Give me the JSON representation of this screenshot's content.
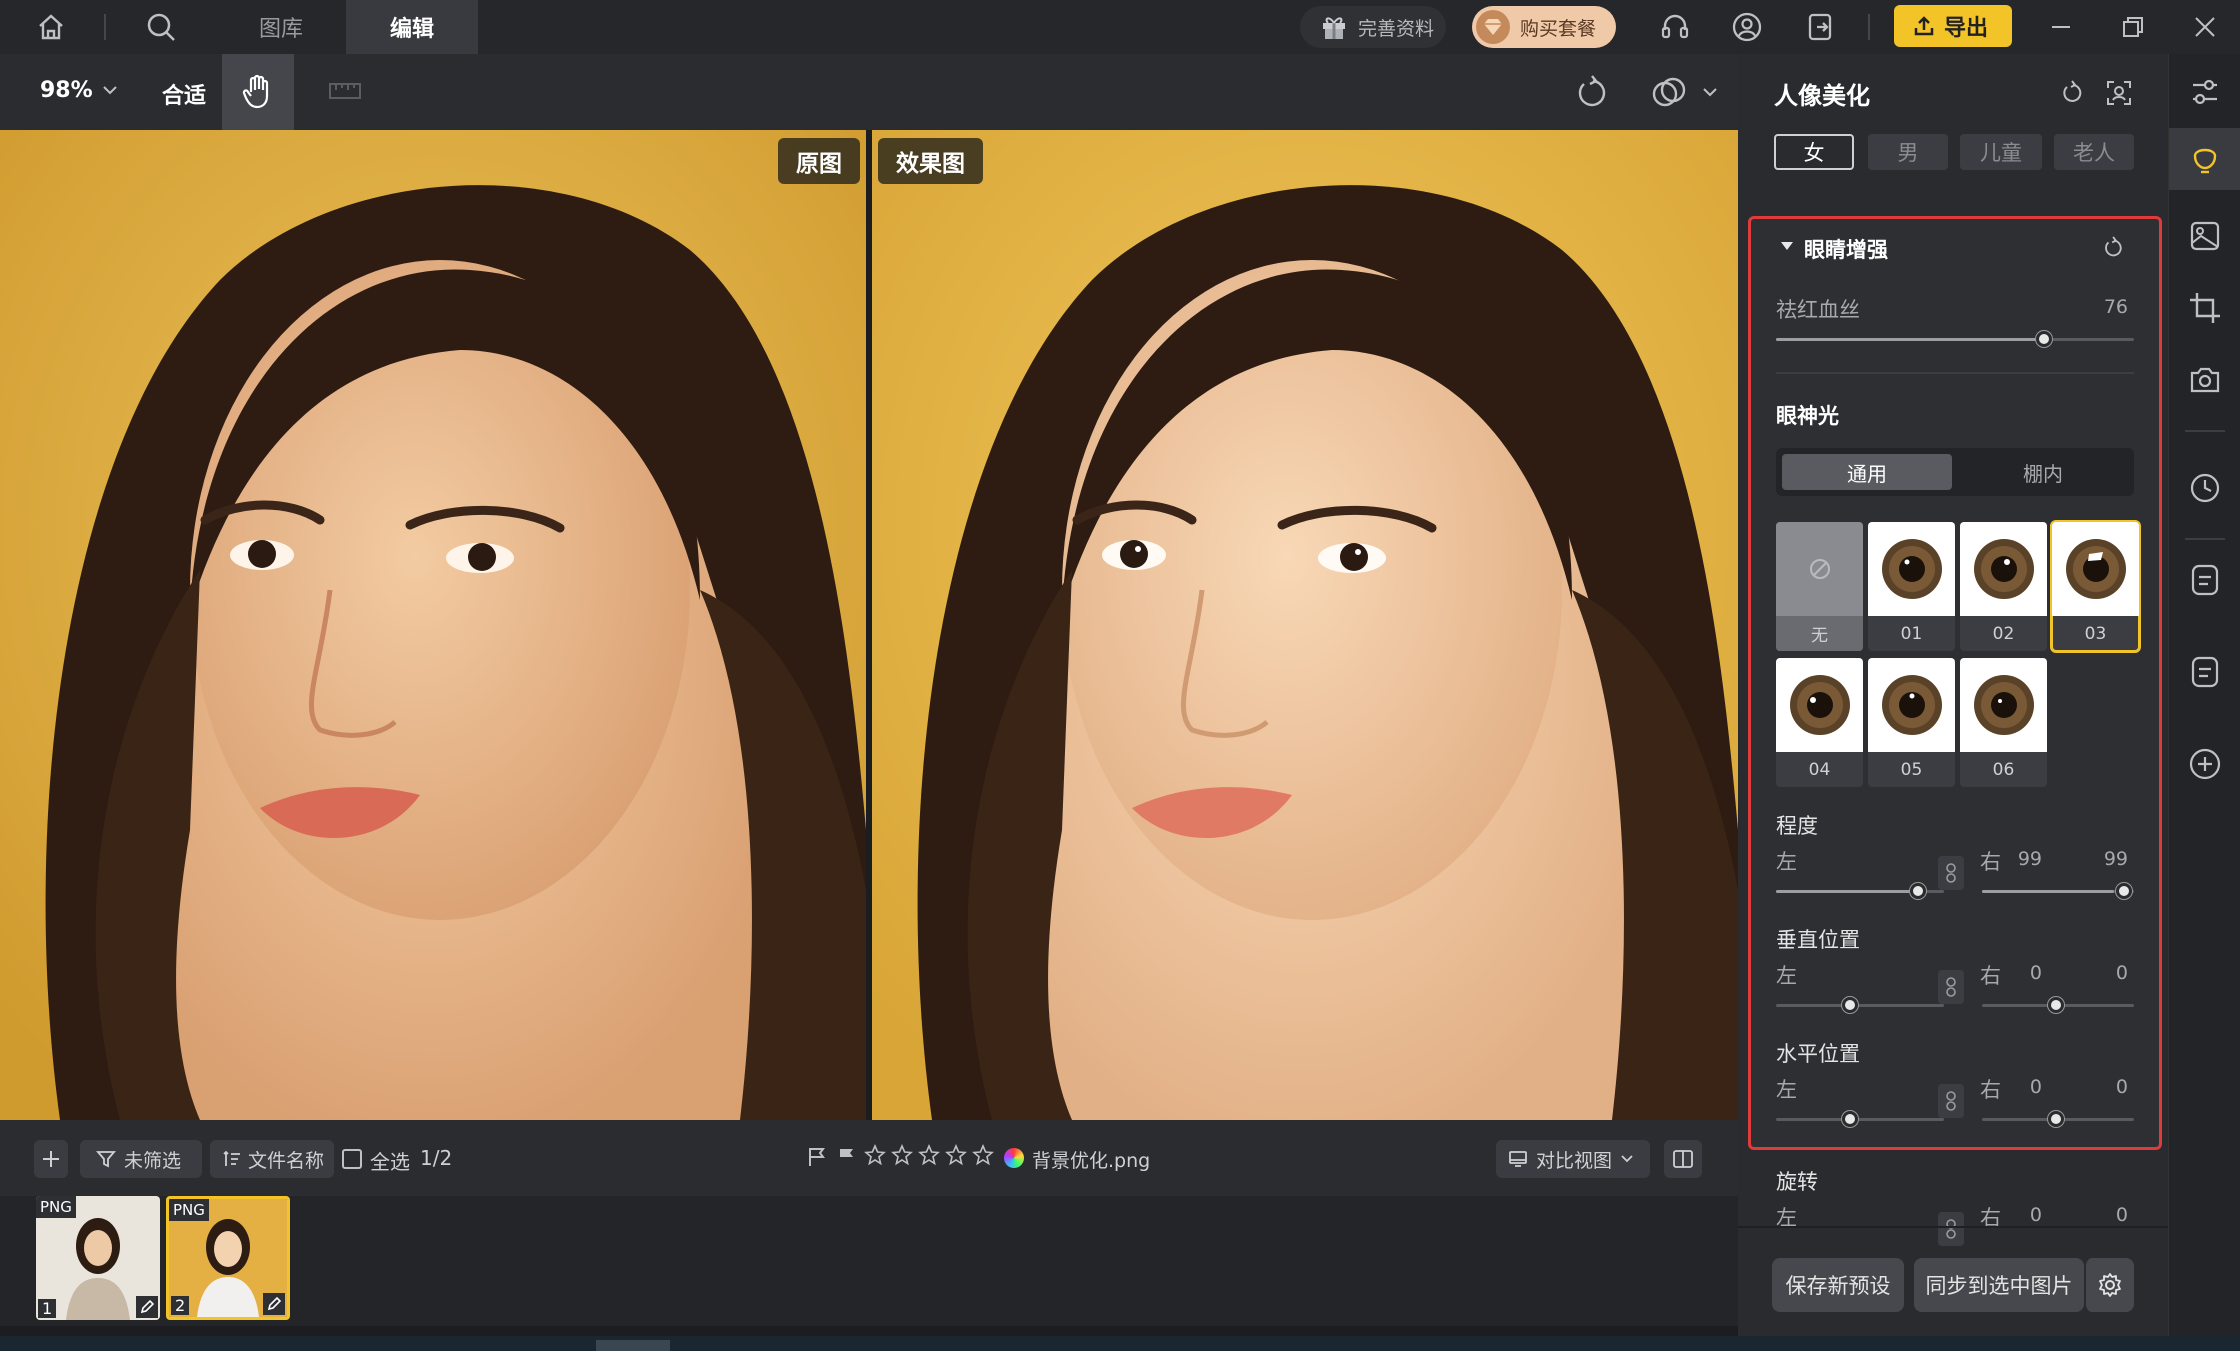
{
  "topbar": {
    "tabs": [
      {
        "label": "图库"
      },
      {
        "label": "编辑"
      }
    ],
    "profile_label": "完善资料",
    "buy_label": "购买套餐",
    "export_label": "导出"
  },
  "toolbar": {
    "zoom": "98%",
    "fit_label": "合适"
  },
  "canvas": {
    "original_label": "原图",
    "effect_label": "效果图"
  },
  "bottombar": {
    "filter_label": "未筛选",
    "sort_label": "文件名称",
    "select_all_label": "全选",
    "select_count": "1/2",
    "filename": "背景优化.png",
    "rating_stars": 5,
    "view_mode_label": "对比视图"
  },
  "thumbs": [
    {
      "badge": "PNG",
      "index": "1"
    },
    {
      "badge": "PNG",
      "index": "2"
    }
  ],
  "panel": {
    "title": "人像美化",
    "gender_tabs": [
      "女",
      "男",
      "儿童",
      "老人"
    ],
    "section_title": "眼睛增强",
    "redness_label": "祛红血丝",
    "redness_value": "76",
    "catchlight_title": "眼神光",
    "catchlight_tabs": [
      "通用",
      "棚内"
    ],
    "presets": [
      "无",
      "01",
      "02",
      "03",
      "04",
      "05",
      "06"
    ],
    "degree_title": "程度",
    "vertical_title": "垂直位置",
    "horizontal_title": "水平位置",
    "rotation_title": "旋转",
    "left": "左",
    "right": "右",
    "degree_left": "99",
    "degree_right": "99",
    "vertical_left": "0",
    "vertical_right": "0",
    "horizontal_left": "0",
    "horizontal_right": "0",
    "rotation_left": "0",
    "rotation_right": "0",
    "save_preset_label": "保存新预设",
    "sync_label": "同步到选中图片"
  },
  "colors": {
    "accent_yellow": "#f3c428",
    "highlight_red": "#e03b3b",
    "photo_bg": "#e2b345"
  }
}
